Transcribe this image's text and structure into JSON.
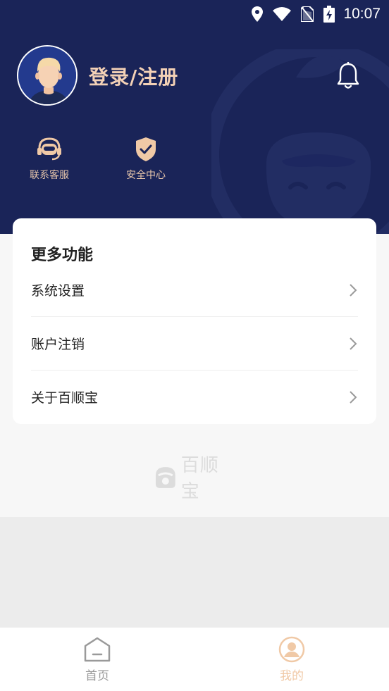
{
  "status_bar": {
    "time": "10:07",
    "icons": [
      "location-icon",
      "wifi-icon",
      "no-sim-icon",
      "battery-charging-icon"
    ]
  },
  "header": {
    "login_label": "登录/注册",
    "quick_actions": [
      {
        "label": "联系客服",
        "icon": "headset-icon"
      },
      {
        "label": "安全中心",
        "icon": "shield-check-icon"
      }
    ]
  },
  "more_features": {
    "title": "更多功能",
    "items": [
      {
        "label": "系统设置"
      },
      {
        "label": "账户注销"
      },
      {
        "label": "关于百顺宝"
      }
    ]
  },
  "brand": {
    "name": "百顺宝"
  },
  "tabbar": {
    "items": [
      {
        "label": "首页",
        "icon": "home-icon",
        "active": false
      },
      {
        "label": "我的",
        "icon": "profile-icon",
        "active": true
      }
    ]
  },
  "colors": {
    "header_bg": "#1a2458",
    "accent": "#f3c8a3",
    "tab_inactive": "#9a9a9a",
    "tab_active": "#f0c9a6"
  }
}
